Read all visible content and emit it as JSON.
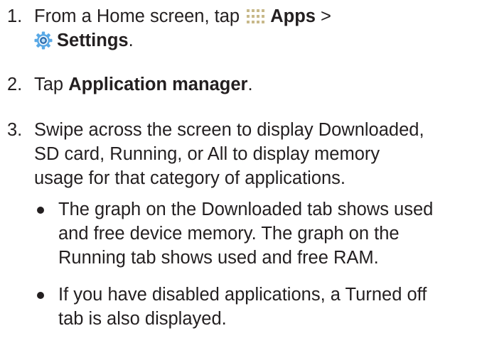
{
  "steps": [
    {
      "number": "1.",
      "line1_prefix": "From a Home screen, tap",
      "apps_label": "Apps",
      "line1_suffix": ">",
      "settings_label": "Settings",
      "line2_suffix": ".",
      "apps_icon": "apps-grid-icon",
      "settings_icon": "gear-icon"
    },
    {
      "number": "2.",
      "prefix": "Tap",
      "bold": "Application manager",
      "suffix": "."
    },
    {
      "number": "3.",
      "lines": [
        "Swipe across the screen to display Downloaded,",
        "SD card, Running, or All to display memory",
        "usage for that category of applications."
      ]
    }
  ],
  "bullets": [
    {
      "lines": [
        "The graph on the Downloaded tab shows used",
        "and free device memory. The graph on the",
        "Running tab shows used and free RAM."
      ]
    },
    {
      "lines": [
        "If you have disabled applications, a Turned off",
        "tab is also displayed."
      ]
    }
  ],
  "colors": {
    "text": "#231f20",
    "apps_icon": "#c8b98a",
    "gear_outer": "#5aa9e6",
    "gear_inner": "#2f6fb0"
  }
}
